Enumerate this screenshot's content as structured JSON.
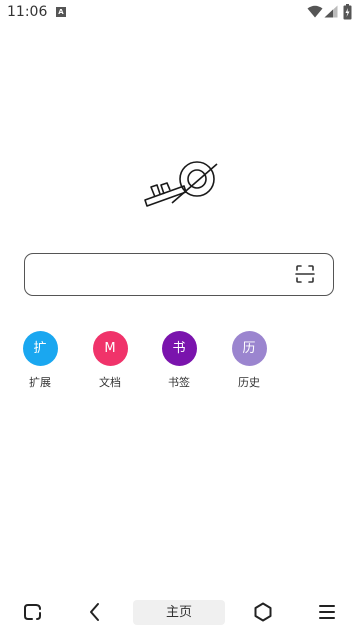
{
  "status_bar": {
    "time": "11:06",
    "notification_icon": "A"
  },
  "logo": {
    "icon": "key-logo-icon"
  },
  "search": {
    "value": "",
    "scan_icon": "scan-icon"
  },
  "shortcuts": [
    {
      "glyph": "扩",
      "label": "扩展",
      "color": "#1aa7f0"
    },
    {
      "glyph": "M",
      "label": "文档",
      "color": "#f0336a"
    },
    {
      "glyph": "书",
      "label": "书签",
      "color": "#7a14ad"
    },
    {
      "glyph": "历",
      "label": "历史",
      "color": "#9b85cf"
    }
  ],
  "bottom_nav": {
    "home_label": "主页",
    "icons": [
      "tabs-icon",
      "back-icon",
      "home-icon",
      "menu-icon"
    ]
  }
}
